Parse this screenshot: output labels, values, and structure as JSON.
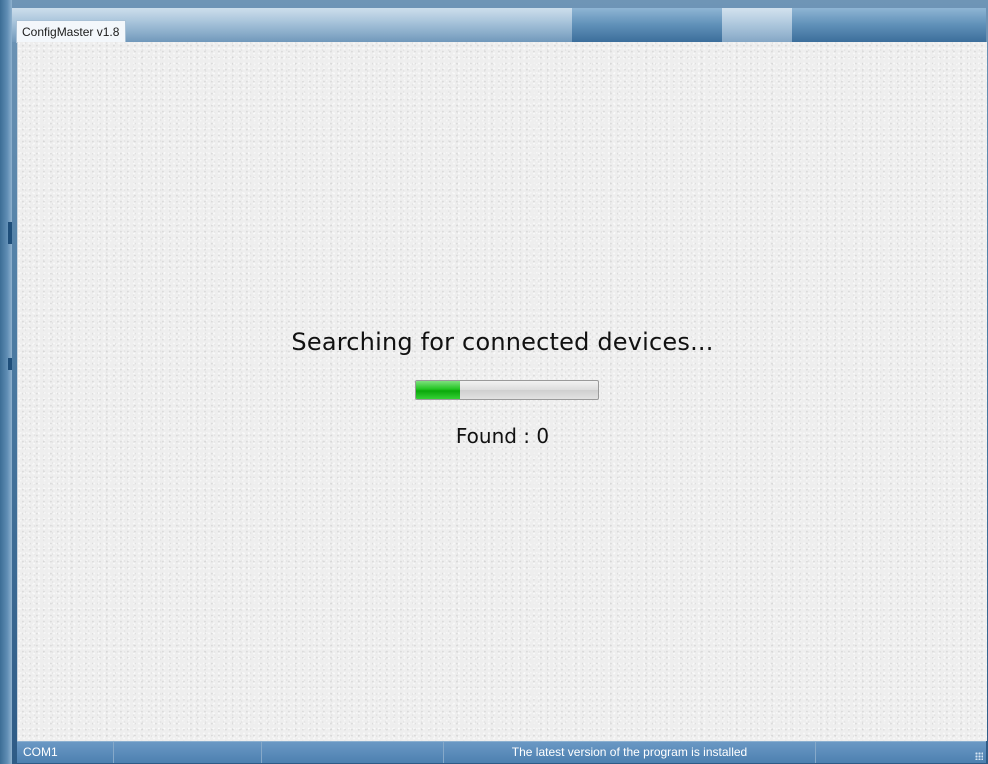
{
  "window": {
    "title": "ConfigMaster v1.8"
  },
  "main": {
    "status_message": "Searching for connected devices...",
    "progress_fraction": 0.24,
    "found_label": "Found",
    "found_separator": ":",
    "found_count": "0"
  },
  "statusbar": {
    "port": "COM1",
    "panel2": "",
    "panel3": "",
    "version_message": "The latest version of the program is installed"
  },
  "colors": {
    "progress_fill": "#22c422",
    "statusbar": "#4d80b0"
  }
}
